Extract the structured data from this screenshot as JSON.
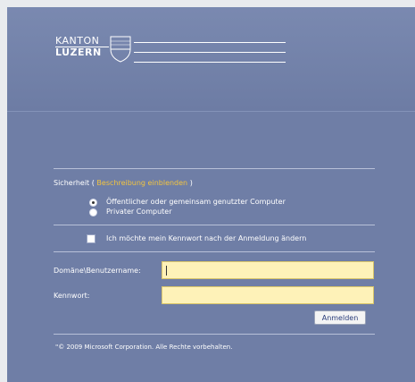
{
  "header": {
    "logo_line1": "KANTON",
    "logo_line2": "LUZERN"
  },
  "security": {
    "label_prefix": "Sicherheit (",
    "show_description_link": "Beschreibung einblenden",
    "label_suffix": ")",
    "options": [
      {
        "label": "Öffentlicher oder gemeinsam genutzter Computer",
        "selected": true
      },
      {
        "label": "Privater Computer",
        "selected": false
      }
    ]
  },
  "change_password": {
    "label": "Ich möchte mein Kennwort nach der Anmeldung ändern",
    "checked": false
  },
  "form": {
    "username_label": "Domäne\\Benutzername:",
    "username_value": "",
    "password_label": "Kennwort:",
    "password_value": "",
    "submit_label": "Anmelden"
  },
  "footer": {
    "copyright": "\"© 2009 Microsoft Corporation. Alle Rechte vorbehalten."
  },
  "colors": {
    "background": "#6f7ea6",
    "input_background": "#fef2b8",
    "link": "#f2c440"
  }
}
